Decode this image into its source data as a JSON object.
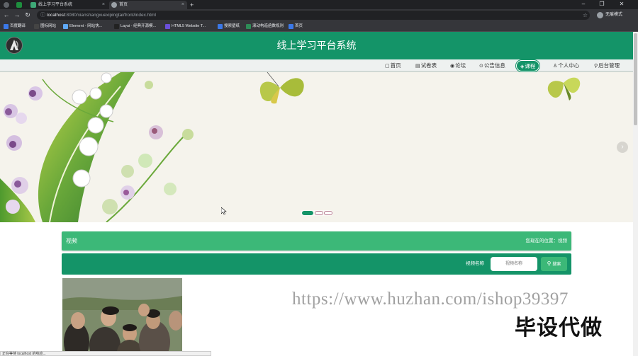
{
  "browser": {
    "tabs": [
      {
        "title": "线上学习平台系统",
        "active": false
      },
      {
        "title": "首页",
        "active": true
      }
    ],
    "new_tab": "+",
    "url_host": "localhost",
    "url_rest": ":8080/xianshangxuexipingtai/front/index.html",
    "profile_label": "无痕模式",
    "bookmarks": [
      "百度翻译",
      "图标网站",
      "Element - 网站快...",
      "Layui - 经典开源模...",
      "HTML5 Website T...",
      "搜索壁纸",
      "滚动构造函数规则",
      "首页"
    ],
    "bookmark_colors": [
      "#3b78e7",
      "#444444",
      "#5fa8f5",
      "#222222",
      "#6a4fd8",
      "#3b78e7",
      "#2e8b57",
      "#3b78e7"
    ]
  },
  "site": {
    "title": "线上学习平台系统",
    "nav": [
      {
        "icon": "▢",
        "label": "首页"
      },
      {
        "icon": "▤",
        "label": "试卷表"
      },
      {
        "icon": "◉",
        "label": "论坛"
      },
      {
        "icon": "⊙",
        "label": "公告信息"
      },
      {
        "icon": "◈",
        "label": "课程",
        "active": true
      },
      {
        "icon": "♙",
        "label": "个人中心"
      },
      {
        "icon": "⚲",
        "label": "后台管理"
      }
    ]
  },
  "content": {
    "section_title": "视频",
    "location_label": "您现在的位置：",
    "location_value": "视频",
    "search_label": "视频名称",
    "search_placeholder": "视频名称",
    "search_button": "搜索"
  },
  "overlay": {
    "watermark": "https://www.huzhan.com/ishop39397",
    "stamp": "毕设代做"
  },
  "status_text": "正在等待 localhost 的响应...",
  "colors": {
    "primary": "#149468",
    "secondary": "#3cb878"
  }
}
